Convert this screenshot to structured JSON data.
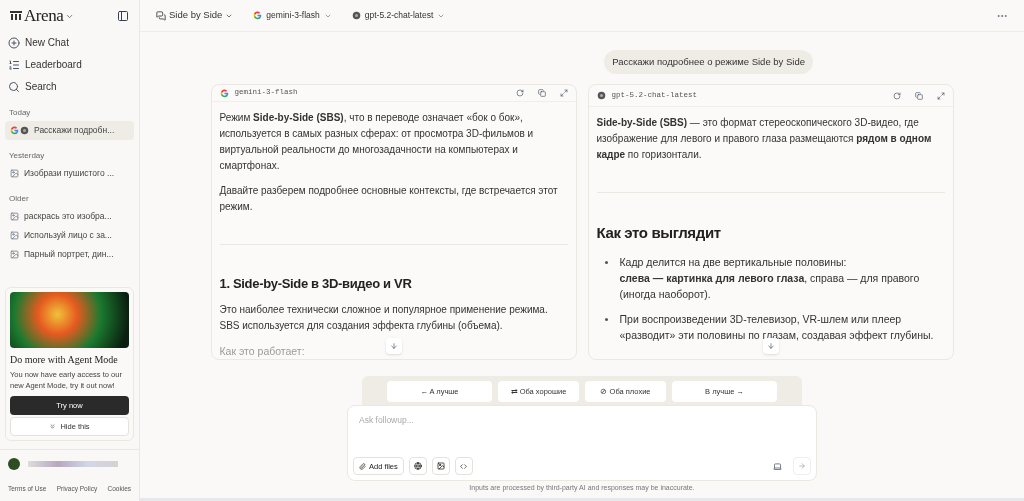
{
  "sidebar": {
    "logo": "Arena",
    "nav": [
      {
        "kind": "new",
        "label": "New Chat"
      },
      {
        "kind": "leaderboard",
        "label": "Leaderboard"
      },
      {
        "kind": "search",
        "label": "Search"
      }
    ],
    "groups": [
      {
        "title": "Today",
        "items": [
          {
            "label": "Расскажи подробн...",
            "kind": "models",
            "selected": true
          }
        ]
      },
      {
        "title": "Yesterday",
        "items": [
          {
            "label": "Изобрази пушистого ...",
            "kind": "image",
            "selected": false
          }
        ]
      },
      {
        "title": "Older",
        "items": [
          {
            "label": "раскрась это изобра...",
            "kind": "image",
            "selected": false
          },
          {
            "label": "Используй лицо с за...",
            "kind": "image",
            "selected": false
          },
          {
            "label": "Парный портрет, дин...",
            "kind": "image",
            "selected": false
          }
        ]
      }
    ],
    "promo": {
      "title": "Do more with Agent Mode",
      "text": "You now have early access to our new Agent Mode, try it out now!",
      "primary": "Try now",
      "secondary": "Hide this"
    },
    "footer_links": [
      "Terms of Use",
      "Privacy Policy",
      "Cookies"
    ]
  },
  "topbar": {
    "mode": "Side by Side",
    "models": [
      {
        "kind": "google",
        "name": "gemini-3-flash"
      },
      {
        "kind": "openai",
        "name": "gpt-5.2-chat-latest"
      }
    ]
  },
  "prompt": "Расскажи подробнее о режиме Side by Side",
  "panels": [
    {
      "kind": "google",
      "model": "gemini-3-flash",
      "blocks": [
        {
          "kind": "p",
          "text": "Режим **Side-by-Side (SBS)**, что в переводе означает «бок о бок», используется в самых разных сферах: от просмотра 3D-фильмов и виртуальной реальности до многозадачности на компьютерах и смартфонах."
        },
        {
          "kind": "p",
          "text": "Давайте разберем подробнее основные контексты, где встречается этот режим."
        },
        {
          "kind": "hr"
        },
        {
          "kind": "h3",
          "text": "1. Side-by-Side в 3D-видео и VR"
        },
        {
          "kind": "p",
          "text": "Это наиболее технически сложное и популярное применение режима. SBS используется для создания эффекта глубины (объема)."
        },
        {
          "kind": "faded",
          "text": "Как это работает:"
        }
      ]
    },
    {
      "kind": "openai",
      "model": "gpt-5.2-chat-latest",
      "blocks": [
        {
          "kind": "p",
          "text": "**Side-by-Side (SBS)** — это формат стереоскопического 3D-видео, где изображение для левого и правого глаза размещаются **рядом в одном кадре** по горизонтали."
        },
        {
          "kind": "hr"
        },
        {
          "kind": "h2",
          "text": "Как это выглядит"
        },
        {
          "kind": "li",
          "text": "Кадр делится на две вертикальные половины:",
          "sub": "**слева — картинка для левого глаза**, справа — для правого (иногда наоборот)."
        },
        {
          "kind": "li",
          "text": "При воспроизведении 3D-телевизор, VR-шлем или плеер «разводит» эти половины по глазам, создавая эффект глубины."
        }
      ]
    }
  ],
  "votes": [
    {
      "kind": "left",
      "label": "← A лучше"
    },
    {
      "kind": "tie",
      "label": "⇄ Оба хорошие"
    },
    {
      "kind": "bad",
      "label": "⊘ Оба плохие"
    },
    {
      "kind": "right",
      "label": "B лучше →"
    }
  ],
  "composer": {
    "placeholder": "Ask followup...",
    "add_files": "Add files"
  },
  "disclaimer": "Inputs are processed by third-party AI and responses may be inaccurate."
}
